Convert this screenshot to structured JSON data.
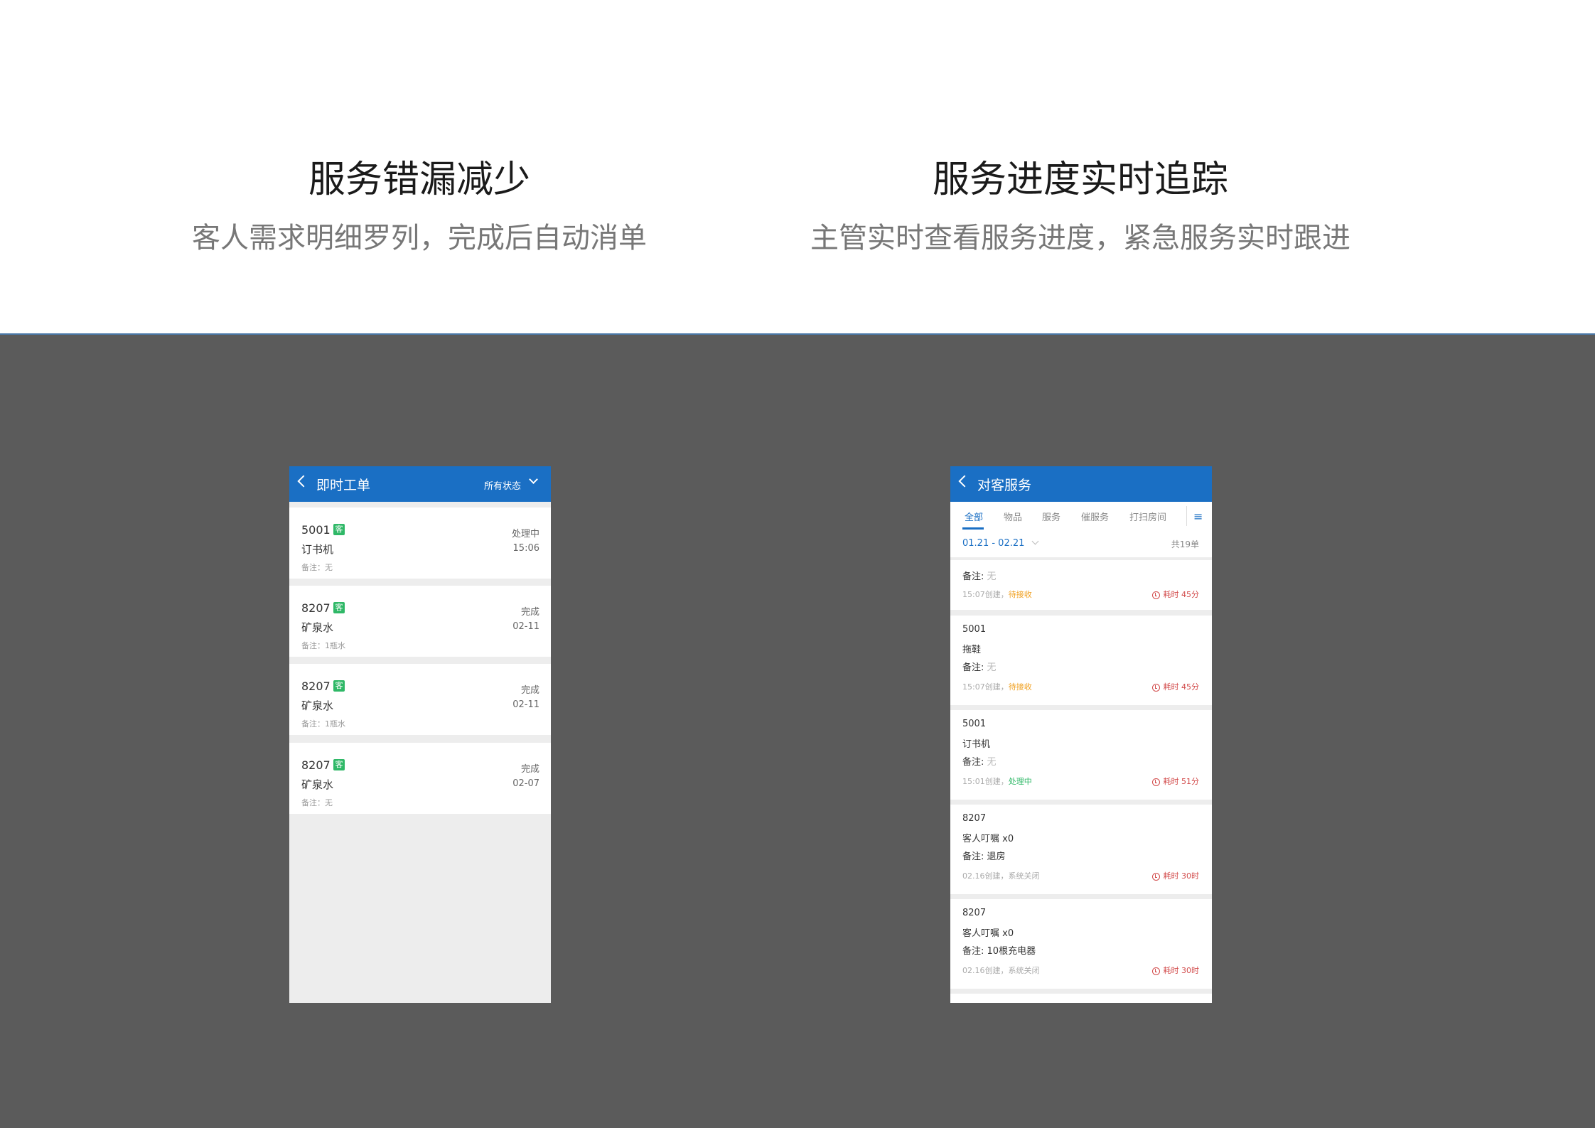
{
  "headline_left": {
    "title": "服务错漏减少",
    "subtitle": "客人需求明细罗列，完成后自动消单"
  },
  "headline_right": {
    "title": "服务进度实时追踪",
    "subtitle": "主管实时查看服务进度，紧急服务实时跟进"
  },
  "phone_left": {
    "title": "即时工单",
    "filter": "所有状态",
    "orders": [
      {
        "room": "5001",
        "tag": "客",
        "item": "订书机",
        "note": "备注：无",
        "status": "处理中",
        "time": "15:06"
      },
      {
        "room": "8207",
        "tag": "客",
        "item": "矿泉水",
        "note": "备注：1瓶水",
        "status": "完成",
        "time": "02-11"
      },
      {
        "room": "8207",
        "tag": "客",
        "item": "矿泉水",
        "note": "备注：1瓶水",
        "status": "完成",
        "time": "02-11"
      },
      {
        "room": "8207",
        "tag": "客",
        "item": "矿泉水",
        "note": "备注：无",
        "status": "完成",
        "time": "02-07"
      }
    ]
  },
  "phone_right": {
    "title": "对客服务",
    "tabs": [
      "全部",
      "物品",
      "服务",
      "催服务",
      "打扫房间"
    ],
    "date_range": "01.21 - 02.21",
    "count": "共19单",
    "services": [
      {
        "room": "",
        "item": "",
        "note_label": "备注:",
        "note_value": "无",
        "created": "15:07创建，",
        "status": "待接收",
        "duration": "耗时 45分"
      },
      {
        "room": "5001",
        "item": "拖鞋",
        "note_label": "备注:",
        "note_value": "无",
        "created": "15:07创建，",
        "status": "待接收",
        "duration": "耗时 45分"
      },
      {
        "room": "5001",
        "item": "订书机",
        "note_label": "备注:",
        "note_value": "无",
        "created": "15:01创建，",
        "status": "处理中",
        "duration": "耗时 51分"
      },
      {
        "room": "8207",
        "item": "客人叮嘱 x0",
        "note_label": "备注:",
        "note_value": "退房",
        "created": "02.16创建，",
        "status": "系统关闭",
        "duration": "耗时 30时"
      },
      {
        "room": "8207",
        "item": "客人叮嘱 x0",
        "note_label": "备注:",
        "note_value": "10根充电器",
        "created": "02.16创建，",
        "status": "系统关闭",
        "duration": "耗时 30时"
      }
    ]
  },
  "colors": {
    "accent": "#1a6fc4",
    "dark_bg": "#5b5b5b",
    "tag_green": "#2fb867",
    "warn": "#d24a4a",
    "pending": "#f0a020"
  }
}
